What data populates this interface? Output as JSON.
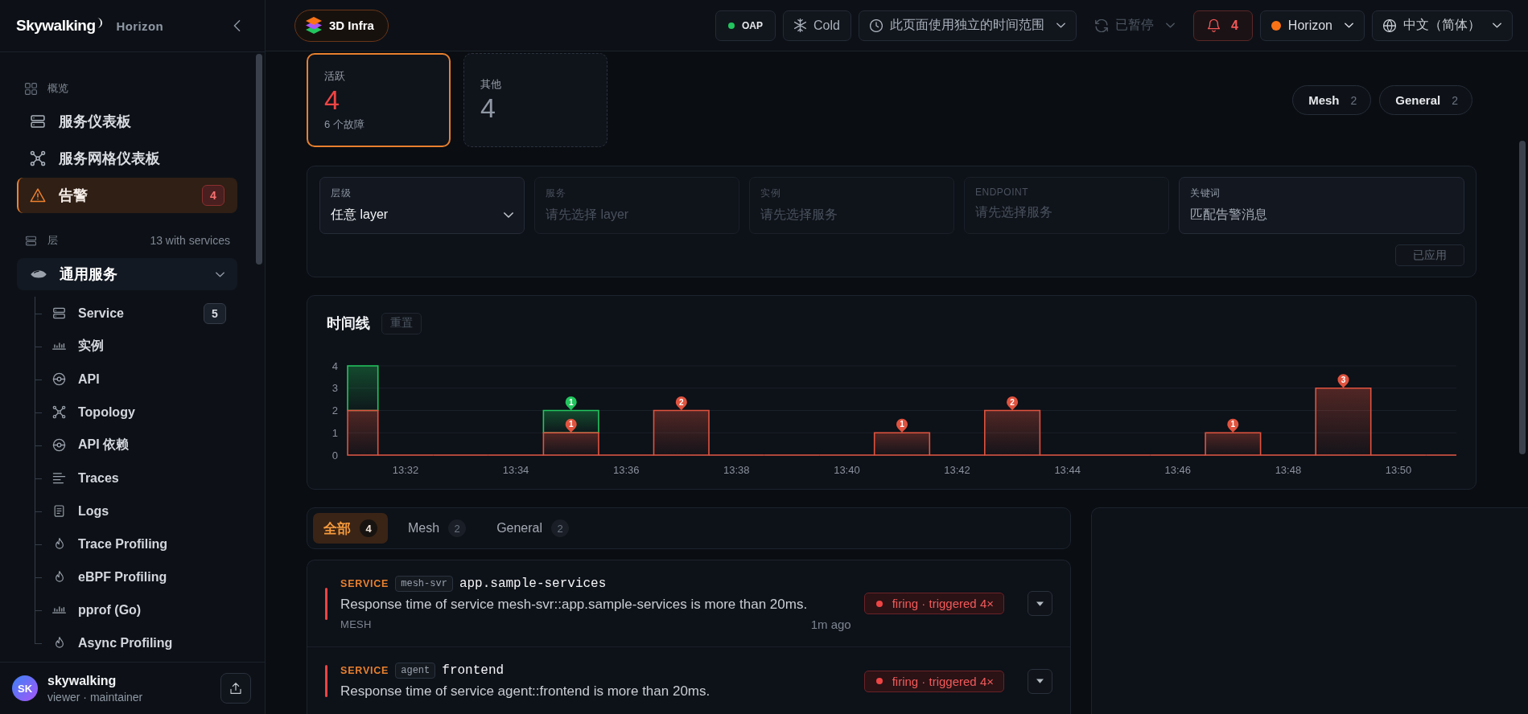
{
  "sidebar": {
    "logo": "Skywalking",
    "product": "Horizon",
    "overview": {
      "heading": "概览",
      "items": [
        {
          "label": "服务仪表板",
          "selected": false
        },
        {
          "label": "服务网格仪表板",
          "selected": false
        },
        {
          "label": "告警",
          "selected": true,
          "badge": "4"
        }
      ]
    },
    "layers": {
      "heading": "层",
      "summary": "13 with services",
      "groups": [
        {
          "label": "通用服务",
          "expanded": true,
          "children": [
            {
              "label": "Service",
              "badge": "5",
              "selected": false
            },
            {
              "label": "实例",
              "selected": false
            },
            {
              "label": "API",
              "selected": false
            },
            {
              "label": "Topology",
              "selected": false
            },
            {
              "label": "API 依赖",
              "selected": false
            },
            {
              "label": "Traces",
              "selected": false
            },
            {
              "label": "Logs",
              "selected": false
            },
            {
              "label": "Trace Profiling",
              "selected": false
            },
            {
              "label": "eBPF Profiling",
              "selected": false
            },
            {
              "label": "pprof (Go)",
              "selected": false
            },
            {
              "label": "Async Profiling",
              "selected": false
            }
          ]
        }
      ]
    },
    "user": {
      "initials": "SK",
      "name": "skywalking",
      "roles": "viewer · maintainer"
    }
  },
  "top_bar": {
    "context": "3D Infra",
    "oap": {
      "label": "OAP",
      "online": true
    },
    "temperature": "Cold",
    "time_range": "此页面使用独立的时间范围",
    "auto_refresh": {
      "label": "已暂停",
      "disabled": true
    },
    "alerts": {
      "count": "4"
    },
    "instance": "Horizon",
    "language": "中文（简体）"
  },
  "status_cards": [
    {
      "kind": "active",
      "label": "活跃",
      "value": "4",
      "note": "6 个故障",
      "selected": true
    },
    {
      "kind": "other",
      "label": "其他",
      "value": "4",
      "selected": false
    }
  ],
  "layer_chips": [
    {
      "label": "Mesh",
      "count": "2",
      "selected": false
    },
    {
      "label": "General",
      "count": "2",
      "selected": false
    }
  ],
  "filters": {
    "fields": [
      {
        "kind": "select",
        "label": "层级",
        "value": "任意 layer",
        "disabled": false
      },
      {
        "kind": "text",
        "label": "服务",
        "placeholder": "请先选择 layer",
        "disabled": true
      },
      {
        "kind": "text",
        "label": "实例",
        "placeholder": "请先选择服务",
        "disabled": true
      },
      {
        "kind": "text",
        "label": "ENDPOINT",
        "placeholder": "请先选择服务",
        "disabled": true
      },
      {
        "kind": "text",
        "label": "关键词",
        "placeholder": "匹配告警消息",
        "disabled": false
      }
    ],
    "apply_button": {
      "label": "已应用",
      "disabled": true
    }
  },
  "timeline": {
    "title": "时间线",
    "reset_button": {
      "label": "重置",
      "disabled": true
    },
    "chart_data": {
      "type": "bar",
      "stacked": true,
      "grid": true,
      "categories": [
        null,
        "13:32",
        null,
        "13:34",
        null,
        "13:36",
        null,
        "13:38",
        null,
        "13:40",
        null,
        "13:42",
        null,
        "13:44",
        null,
        "13:46",
        null,
        "13:48",
        null,
        "13:50",
        null
      ],
      "series": [
        {
          "color": "#e0533f",
          "values": [
            2,
            0,
            0,
            0,
            1,
            0,
            2,
            0,
            0,
            0,
            1,
            0,
            2,
            0,
            0,
            0,
            1,
            0,
            3,
            0,
            0
          ],
          "value_labels": [
            null,
            null,
            null,
            null,
            "1",
            null,
            "2",
            null,
            null,
            null,
            "1",
            null,
            "2",
            null,
            null,
            null,
            "1",
            null,
            "3",
            null,
            null
          ]
        },
        {
          "color": "#22c55e",
          "values": [
            2,
            null,
            null,
            null,
            1,
            null,
            null,
            null,
            null,
            null,
            null,
            null,
            null,
            null,
            null,
            null,
            null,
            null,
            null,
            null,
            null
          ],
          "value_labels": [
            null,
            null,
            null,
            null,
            "1",
            null,
            null,
            null,
            null,
            null,
            null,
            null,
            null,
            null,
            null,
            null,
            null,
            null,
            null,
            null,
            null
          ]
        }
      ],
      "ylim": [
        0,
        4
      ],
      "yticks": [
        0,
        1,
        2,
        3,
        4
      ]
    }
  },
  "alert_tabs": [
    {
      "label": "全部",
      "count": "4",
      "selected": true
    },
    {
      "label": "Mesh",
      "count": "2",
      "selected": false
    },
    {
      "label": "General",
      "count": "2",
      "selected": false
    }
  ],
  "alerts": [
    {
      "scope": "SERVICE",
      "layer_tag": "mesh-svr",
      "name": "app.sample-services",
      "message": "Response time of service mesh-svr::app.sample-services is more than 20ms.",
      "layer": "MESH",
      "time": "1m ago",
      "status": "firing · triggered 4×",
      "firing": true
    },
    {
      "scope": "SERVICE",
      "layer_tag": "agent",
      "name": "frontend",
      "message": "Response time of service agent::frontend is more than 20ms.",
      "status": "firing · triggered 4×",
      "firing": true
    }
  ]
}
